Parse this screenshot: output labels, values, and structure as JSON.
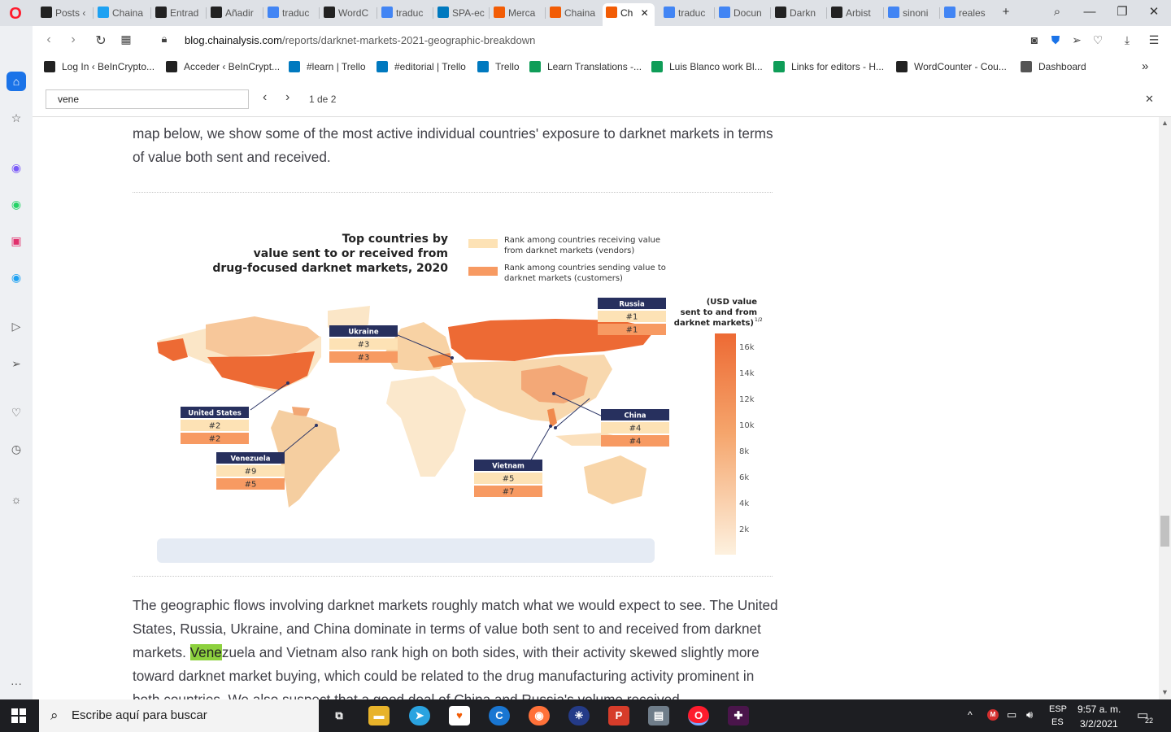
{
  "tabs": [
    {
      "title": "Posts ‹",
      "icon": "beincrypto-favicon",
      "color": "#222"
    },
    {
      "title": "Chaina",
      "icon": "twitter-favicon",
      "color": "#1da1f2"
    },
    {
      "title": "Entrad",
      "icon": "beincrypto-favicon",
      "color": "#222"
    },
    {
      "title": "Añadir",
      "icon": "beincrypto-favicon",
      "color": "#222"
    },
    {
      "title": "traduc",
      "icon": "google-favicon",
      "color": "#4285f4"
    },
    {
      "title": "WordC",
      "icon": "wordcounter-favicon",
      "color": "#222"
    },
    {
      "title": "traduc",
      "icon": "google-favicon",
      "color": "#4285f4"
    },
    {
      "title": "SPA-ec",
      "icon": "trello-favicon",
      "color": "#0079bf"
    },
    {
      "title": "Merca",
      "icon": "coinmarketcap-favicon",
      "color": "#f25c05"
    },
    {
      "title": "Chaina",
      "icon": "chainalysis-favicon",
      "color": "#f25c05"
    },
    {
      "title": "Ch",
      "icon": "chainalysis-favicon",
      "color": "#f25c05",
      "active": true
    },
    {
      "title": "traduc",
      "icon": "google-favicon",
      "color": "#4285f4"
    },
    {
      "title": "Docun",
      "icon": "google-docs-favicon",
      "color": "#4285f4"
    },
    {
      "title": "Darkn",
      "icon": "beincrypto-favicon",
      "color": "#222"
    },
    {
      "title": "Arbist",
      "icon": "beincrypto-favicon",
      "color": "#222"
    },
    {
      "title": "sinoni",
      "icon": "google-favicon",
      "color": "#4285f4"
    },
    {
      "title": "reales",
      "icon": "google-favicon",
      "color": "#4285f4"
    }
  ],
  "address": {
    "domain": "blog.chainalysis.com",
    "path": "/reports/darknet-markets-2021-geographic-breakdown"
  },
  "bookmarks": [
    {
      "label": "Log In ‹ BeInCrypto...",
      "icon": "beincrypto-icon",
      "color": "#222"
    },
    {
      "label": "Acceder ‹ BeInCrypt...",
      "icon": "beincrypto-icon",
      "color": "#222"
    },
    {
      "label": "#learn | Trello",
      "icon": "trello-icon",
      "color": "#0079bf"
    },
    {
      "label": "#editorial | Trello",
      "icon": "trello-icon",
      "color": "#0079bf"
    },
    {
      "label": "Trello",
      "icon": "trello-icon",
      "color": "#0079bf"
    },
    {
      "label": "Learn Translations -...",
      "icon": "sheets-icon",
      "color": "#0f9d58"
    },
    {
      "label": "Luis Blanco work Bl...",
      "icon": "sheets-icon",
      "color": "#0f9d58"
    },
    {
      "label": "Links for editors - H...",
      "icon": "sheets-icon",
      "color": "#0f9d58"
    },
    {
      "label": "WordCounter - Cou...",
      "icon": "wordcounter-icon",
      "color": "#222"
    },
    {
      "label": "Dashboard",
      "icon": "document-icon",
      "color": "#555"
    }
  ],
  "find": {
    "query": "vene",
    "count": "1 de 2"
  },
  "article": {
    "para1": "map below, we show some of the most active individual countries' exposure to darknet markets in terms of value both sent and received.",
    "para2_before": "The geographic flows involving darknet markets roughly match what we would expect to see. The United States, Russia, Ukraine, and China dominate in terms of value both sent to and received from darknet markets. ",
    "para2_highlight": "Vene",
    "para2_after": "zuela and Vietnam also rank high on both sides, with their activity skewed slightly more toward darknet market buying, which could be related to the drug manufacturing activity prominent in both countries. We also suspect that a good deal of China and Russia's volume received"
  },
  "figure": {
    "title_lines": [
      "Top countries by",
      "value sent to or received from",
      "drug-focused darknet markets, 2020"
    ],
    "legend": [
      {
        "label": "Rank among countries receiving value from darknet markets (vendors)",
        "color": "#fde2b5"
      },
      {
        "label": "Rank among countries sending value to darknet markets (customers)",
        "color": "#f79a62"
      }
    ],
    "scale_title": "(USD value sent to and from darknet markets)",
    "scale_sup": "1/2",
    "scale_ticks": [
      "16k",
      "14k",
      "12k",
      "10k",
      "8k",
      "6k",
      "4k",
      "2k"
    ],
    "callouts": [
      {
        "country": "Russia",
        "vendor": "#1",
        "customer": "#1"
      },
      {
        "country": "Ukraine",
        "vendor": "#3",
        "customer": "#3"
      },
      {
        "country": "United States",
        "vendor": "#2",
        "customer": "#2"
      },
      {
        "country": "China",
        "vendor": "#4",
        "customer": "#4"
      },
      {
        "country": "Venezuela",
        "vendor": "#9",
        "customer": "#5"
      },
      {
        "country": "Vietnam",
        "vendor": "#5",
        "customer": "#7"
      }
    ]
  },
  "taskbar": {
    "search_placeholder": "Escribe aquí para buscar",
    "lang1": "ESP",
    "lang2": "ES",
    "time": "9:57 a. m.",
    "date": "3/2/2021",
    "notifications": "22"
  }
}
